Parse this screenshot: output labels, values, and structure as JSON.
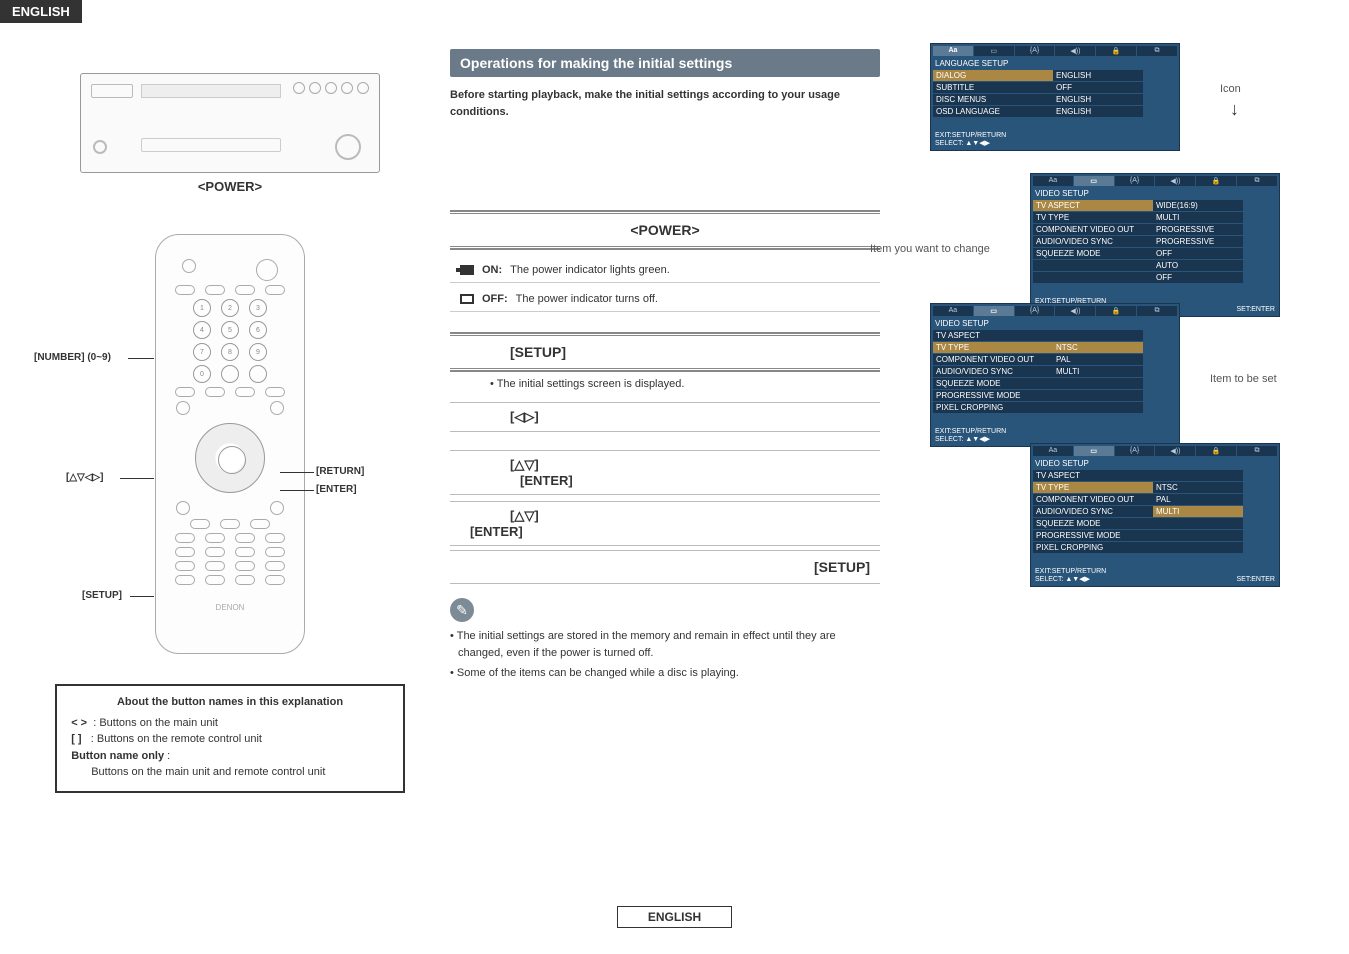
{
  "header": {
    "lang": "ENGLISH"
  },
  "footer": {
    "lang": "ENGLISH"
  },
  "left": {
    "power_label": "<POWER>",
    "callouts": {
      "number": "[NUMBER] (0~9)",
      "arrows": "[△▽◁▷]",
      "return": "[RETURN]",
      "enter": "[ENTER]",
      "setup": "[SETUP]"
    },
    "remote_brand": "DENON",
    "about": {
      "title": "About the button names in this explanation",
      "row1_sym": "<   >",
      "row1_txt": ": Buttons on the main unit",
      "row2_sym": "[   ]",
      "row2_txt": ": Buttons on the remote control unit",
      "row3_lbl": "Button name only",
      "row3_txt": "Buttons on the main unit and remote control unit"
    }
  },
  "mid": {
    "section": "Operations for making the initial settings",
    "lead": "Before starting playback, make the initial settings according to your usage conditions.",
    "power_hdr": "<POWER>",
    "on_lbl": "ON:",
    "on_txt": "The power indicator lights green.",
    "off_lbl": "OFF:",
    "off_txt": "The power indicator turns off.",
    "setup_hdr": "[SETUP]",
    "setup_note": "• The initial settings screen is displayed.",
    "lr": "[◁▷]",
    "ud1": "[△▽]",
    "enter1": "[ENTER]",
    "ud2": "[△▽]",
    "enter2": "[ENTER]",
    "setup_end": "[SETUP]",
    "note1": "The initial settings are stored in the memory and remain in effect until they are changed, even if the power is turned off.",
    "note2": "Some of the items can be changed while a disc is playing."
  },
  "right": {
    "icon_label": "Icon",
    "item_change": "Item you want to change",
    "item_set": "Item to be set",
    "osd_foot_exit": "EXIT:SETUP/RETURN",
    "osd_foot_sel": "SELECT: ▲▼◀▶",
    "osd_foot_set": "SET:ENTER",
    "osd1": {
      "tab_active": "Aa",
      "title": "LANGUAGE SETUP",
      "rows": [
        {
          "l": "DIALOG",
          "v": "ENGLISH",
          "hl": true
        },
        {
          "l": "SUBTITLE",
          "v": "OFF"
        },
        {
          "l": "DISC MENUS",
          "v": "ENGLISH"
        },
        {
          "l": "OSD LANGUAGE",
          "v": "ENGLISH"
        }
      ]
    },
    "osd2": {
      "title": "VIDEO SETUP",
      "rows": [
        {
          "l": "TV ASPECT",
          "v": "WIDE(16:9)",
          "hl": true
        },
        {
          "l": "TV TYPE",
          "v": "MULTI"
        },
        {
          "l": "COMPONENT VIDEO OUT",
          "v": "PROGRESSIVE"
        },
        {
          "l": "AUDIO/VIDEO SYNC",
          "v": "PROGRESSIVE"
        },
        {
          "l": "SQUEEZE MODE",
          "v": "OFF"
        },
        {
          "l": "",
          "v": "AUTO"
        },
        {
          "l": "",
          "v": "OFF"
        }
      ]
    },
    "osd3": {
      "title": "VIDEO SETUP",
      "rows": [
        {
          "l": "TV ASPECT",
          "v": ""
        },
        {
          "l": "TV TYPE",
          "v": "NTSC",
          "hl": true,
          "vhl": true
        },
        {
          "l": "COMPONENT VIDEO OUT",
          "v": "PAL"
        },
        {
          "l": "AUDIO/VIDEO SYNC",
          "v": "MULTI"
        },
        {
          "l": "SQUEEZE MODE",
          "v": ""
        },
        {
          "l": "PROGRESSIVE MODE",
          "v": ""
        },
        {
          "l": "PIXEL CROPPING",
          "v": ""
        }
      ]
    },
    "osd4": {
      "title": "VIDEO SETUP",
      "rows": [
        {
          "l": "TV ASPECT",
          "v": ""
        },
        {
          "l": "TV TYPE",
          "v": "NTSC",
          "hl": true
        },
        {
          "l": "COMPONENT VIDEO OUT",
          "v": "PAL"
        },
        {
          "l": "AUDIO/VIDEO SYNC",
          "v": "MULTI",
          "vhl": true
        },
        {
          "l": "SQUEEZE MODE",
          "v": ""
        },
        {
          "l": "PROGRESSIVE MODE",
          "v": ""
        },
        {
          "l": "PIXEL CROPPING",
          "v": ""
        }
      ]
    }
  }
}
